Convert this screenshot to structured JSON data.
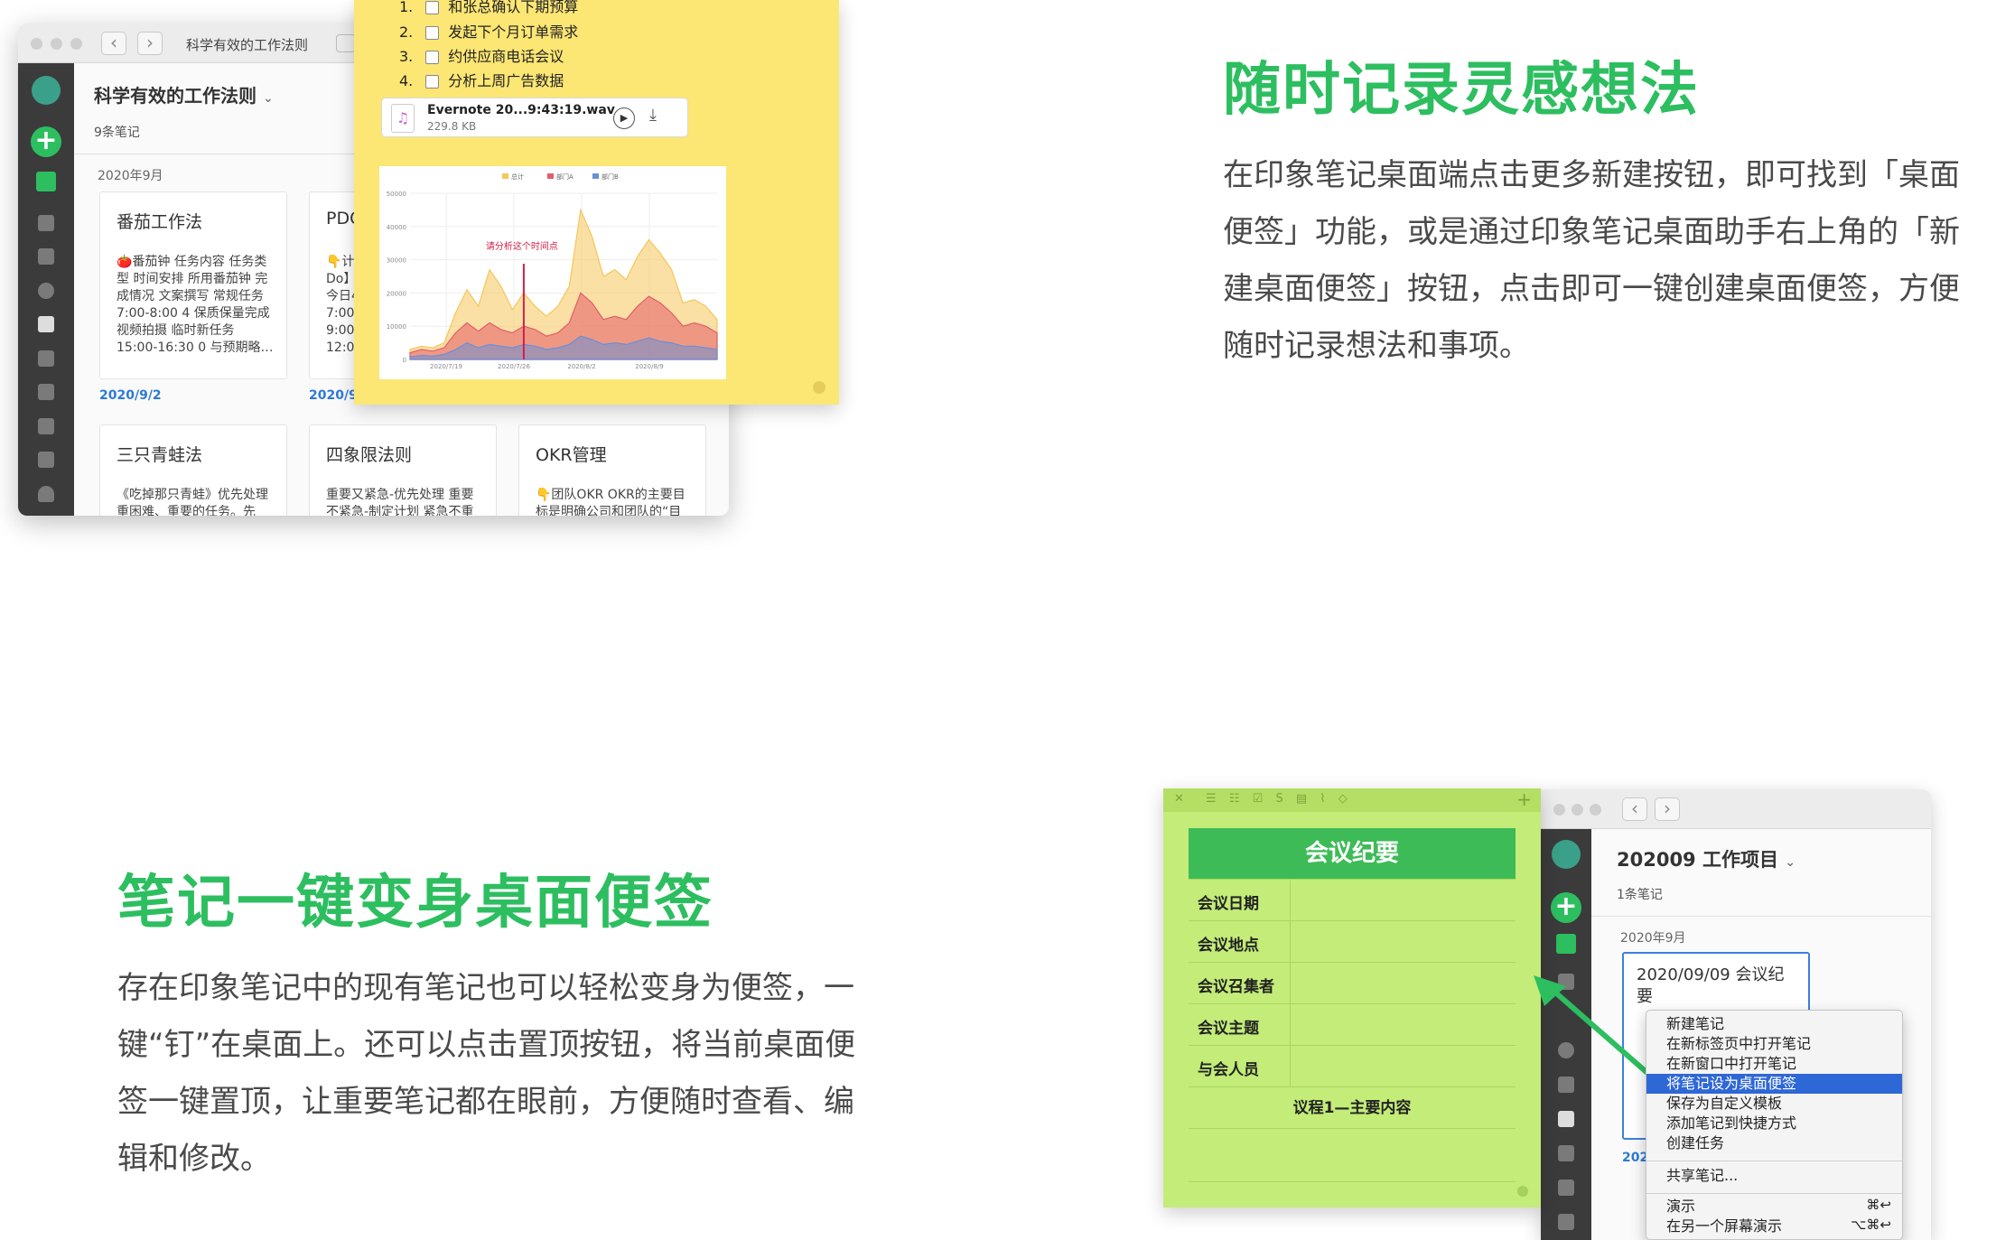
{
  "section1": {
    "heading": "随时记录灵感想法",
    "para_lines": [
      "在印象笔记桌面端点击更多新建按钮，即可找到「桌面",
      "便签」功能，或是通过印象笔记桌面助手右上角的「新",
      "建桌面便签」按钮，点击即可一键创建桌面便签，方便",
      "随时记录想法和事项。"
    ]
  },
  "section2": {
    "heading": "笔记一键变身桌面便签",
    "para_lines": [
      "存在印象笔记中的现有笔记也可以轻松变身为便签，一",
      "键“钉”在桌面上。还可以点击置顶按钮，将当前桌面便",
      "签一键置顶，让重要笔记都在眼前，方便随时查看、编",
      "辑和修改。"
    ]
  },
  "window1": {
    "title": "科学有效的工作法则",
    "notebook": "科学有效的工作法则",
    "count": "9条笔记",
    "month": "2020年9月",
    "cards": [
      {
        "title": "番茄工作法",
        "body": "🍅番茄钟 任务内容 任务类型 时间安排 所用番茄钟 完成情况 文案撰写 常规任务 7:00-8:00 4 保质保量完成 视频拍摄 临时新任务 15:00-16:30 0 与预期略…",
        "date": "2020/9/2"
      },
      {
        "title": "PDC",
        "body": "👇计 Do】 今日4 7:00- 9:00- 12:00",
        "date": "2020/9"
      },
      {
        "title": "三只青蛙法",
        "body": "《吃掉那只青蛙》优先处理重困难、重要的任务。先"
      },
      {
        "title": "四象限法则",
        "body": "重要又紧急-优先处理 重要不紧急-制定计划 紧急不重"
      },
      {
        "title": "OKR管理",
        "body": "👇团队OKR OKR的主要目标是明确公司和团队的“目"
      }
    ]
  },
  "sticky1": {
    "todos": [
      {
        "n": "1.",
        "text": "和张总确认下期预算"
      },
      {
        "n": "2.",
        "text": "发起下个月订单需求"
      },
      {
        "n": "3.",
        "text": "约供应商电话会议"
      },
      {
        "n": "4.",
        "text": "分析上周广告数据"
      }
    ],
    "audio_name": "Evernote 20...9:43:19.wav",
    "audio_size": "229.8 KB",
    "chart_note": "请分析这个时间点"
  },
  "chart_data": {
    "type": "area",
    "title": "",
    "legend": [
      "总计",
      "部门A",
      "部门B"
    ],
    "x_ticks": [
      "2020/7/19",
      "2020/7/26",
      "2020/8/2",
      "2020/8/9"
    ],
    "y_ticks": [
      "50000",
      "40000",
      "30000",
      "20000",
      "10000",
      "0"
    ],
    "ylim": [
      0,
      50000
    ],
    "series": [
      {
        "name": "总计",
        "color": "#f5c65b",
        "values": [
          3000,
          4000,
          3500,
          5000,
          14000,
          21000,
          16000,
          27000,
          22000,
          15000,
          20000,
          16000,
          13000,
          16000,
          22000,
          45000,
          37000,
          25000,
          27000,
          24000,
          31000,
          36000,
          32000,
          27000,
          17000,
          18000,
          16000,
          12000
        ]
      },
      {
        "name": "部门A",
        "color": "#e35d6a",
        "values": [
          2000,
          3000,
          2500,
          3500,
          8000,
          11000,
          8500,
          11000,
          9000,
          8000,
          10000,
          9000,
          7000,
          8000,
          11000,
          20000,
          17000,
          12000,
          13000,
          12000,
          16000,
          19000,
          17000,
          14000,
          10000,
          11000,
          10000,
          8000
        ]
      },
      {
        "name": "部门B",
        "color": "#6b8fd6",
        "values": [
          800,
          1200,
          1000,
          1500,
          3000,
          5000,
          3500,
          4500,
          4000,
          3500,
          4500,
          4000,
          3000,
          3500,
          4500,
          7000,
          6000,
          4500,
          5000,
          4500,
          5500,
          6500,
          5500,
          5000,
          4000,
          4000,
          3500,
          3000
        ]
      }
    ]
  },
  "sticky2": {
    "title": "会议纪要",
    "rows": [
      "会议日期",
      "会议地点",
      "会议召集者",
      "会议主题",
      "与会人员"
    ],
    "agenda": "议程1—主要内容"
  },
  "window2": {
    "notebook": "202009 工作项目",
    "count": "1条笔记",
    "month": "2020年9月",
    "card_title": "2020/09/09 会议纪要",
    "date": "202"
  },
  "context_menu": {
    "items": [
      "新建笔记",
      "在新标签页中打开笔记",
      "在新窗口中打开笔记",
      "将笔记设为桌面便签",
      "保存为自定义模板",
      "添加笔记到快捷方式",
      "创建任务"
    ],
    "share": "共享笔记...",
    "present": "演示",
    "present_key": "⌘↩",
    "present_other": "在另一个屏幕演示",
    "present_other_key": "⌥⌘↩"
  }
}
